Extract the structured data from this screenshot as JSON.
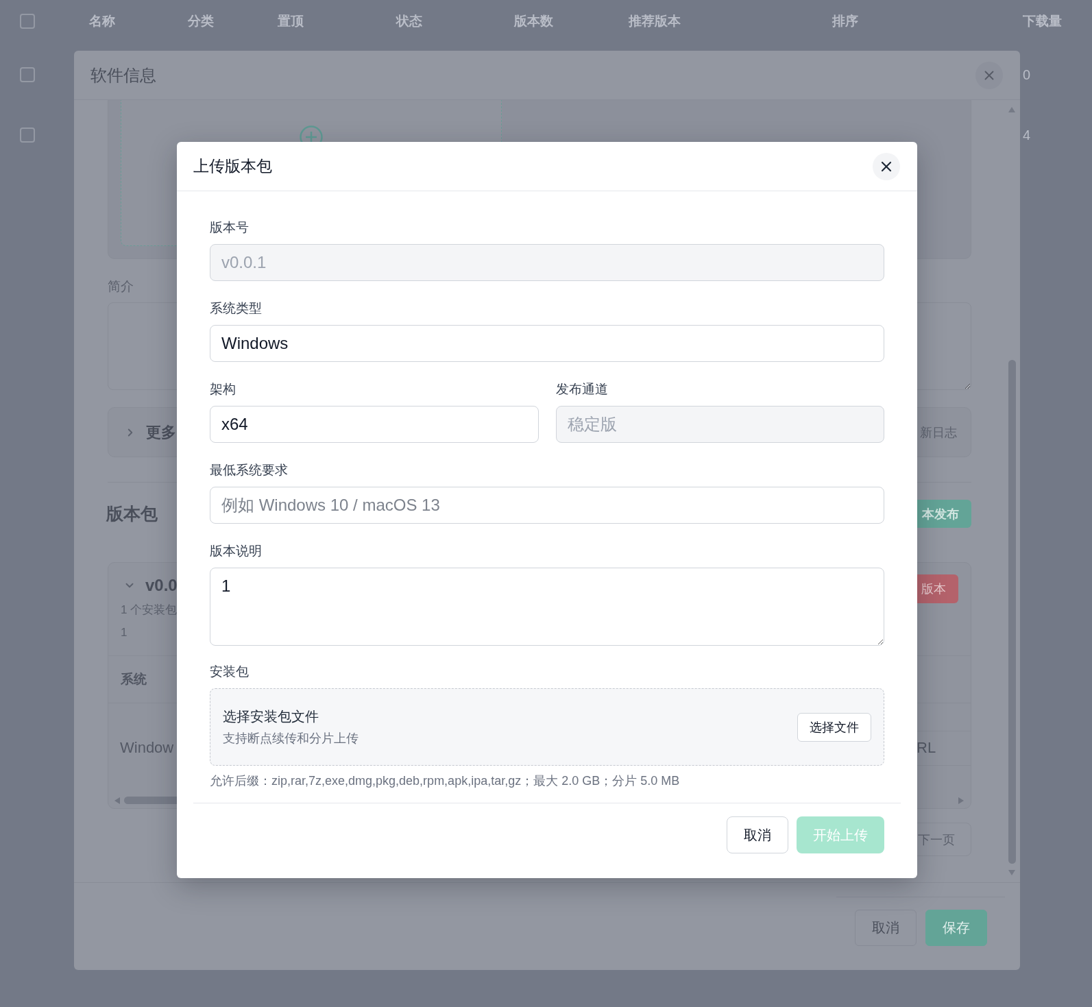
{
  "background_table": {
    "select_all": {
      "checked": false
    },
    "columns": [
      "名称",
      "分类",
      "置顶",
      "状态",
      "版本数",
      "推荐版本",
      "排序",
      "下载量"
    ],
    "rows": [
      {
        "checked": false,
        "downloads": "0"
      },
      {
        "checked": false,
        "downloads": "4"
      }
    ]
  },
  "software_dialog": {
    "title": "软件信息",
    "intro_label": "简介",
    "more_section": {
      "title": "更多",
      "expanded": false,
      "right_label": "新日志"
    },
    "packages_heading": "版本包",
    "publish_button": "本发布",
    "versions": [
      {
        "title": "v0.0",
        "expanded": true,
        "package_count": "1 个安装包",
        "notes": "1",
        "delete_button": "版本",
        "table": {
          "columns": [
            "系统"
          ],
          "rows": [
            {
              "cells": [
                "Window",
                "RL"
              ]
            }
          ]
        }
      }
    ],
    "next_page_button": "下一页",
    "buttons": [
      {
        "label": "取消",
        "kind": "secondary"
      },
      {
        "label": "保存",
        "kind": "primary"
      }
    ]
  },
  "upload_dialog": {
    "title": "上传版本包",
    "field_rows": [
      {
        "fields": [
          {
            "label": "版本号",
            "kind": "input",
            "value": "v0.0.1",
            "disabled": true
          }
        ]
      },
      {
        "fields": [
          {
            "label": "系统类型",
            "kind": "input",
            "value": "Windows",
            "disabled": false
          }
        ]
      },
      {
        "fields": [
          {
            "label": "架构",
            "kind": "input",
            "value": "x64",
            "disabled": false
          },
          {
            "label": "发布通道",
            "kind": "input",
            "value": "稳定版",
            "disabled": true
          }
        ]
      },
      {
        "fields": [
          {
            "label": "最低系统要求",
            "kind": "input",
            "placeholder": "例如 Windows 10 / macOS 13",
            "disabled": false
          }
        ]
      },
      {
        "fields": [
          {
            "label": "版本说明",
            "kind": "textarea",
            "value": "1",
            "disabled": false
          }
        ]
      }
    ],
    "package": {
      "label": "安装包",
      "title": "选择安装包文件",
      "subtitle": "支持断点续传和分片上传",
      "button": "选择文件",
      "hint": "允许后缀：zip,rar,7z,exe,dmg,pkg,deb,rpm,apk,ipa,tar,gz；最大 2.0 GB；分片 5.0 MB"
    },
    "buttons": [
      {
        "label": "取消",
        "kind": "secondary",
        "disabled": false
      },
      {
        "label": "开始上传",
        "kind": "primary",
        "disabled": true
      }
    ]
  }
}
